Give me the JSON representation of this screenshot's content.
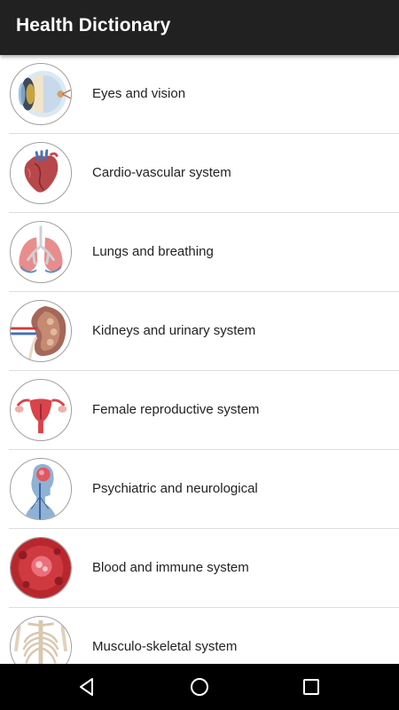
{
  "appbar": {
    "title": "Health Dictionary",
    "background": "#212121"
  },
  "categories": [
    {
      "label": "Eyes and vision",
      "icon": "eye-icon"
    },
    {
      "label": "Cardio-vascular system",
      "icon": "heart-icon"
    },
    {
      "label": "Lungs and breathing",
      "icon": "lungs-icon"
    },
    {
      "label": "Kidneys and urinary system",
      "icon": "kidney-icon"
    },
    {
      "label": "Female reproductive system",
      "icon": "uterus-icon"
    },
    {
      "label": "Psychiatric and neurological",
      "icon": "brain-icon"
    },
    {
      "label": "Blood and immune system",
      "icon": "blood-cell-icon"
    },
    {
      "label": "Musculo-skeletal system",
      "icon": "skeleton-icon"
    }
  ],
  "navigation": {
    "back": "back-icon",
    "home": "home-icon",
    "recents": "recents-icon"
  }
}
